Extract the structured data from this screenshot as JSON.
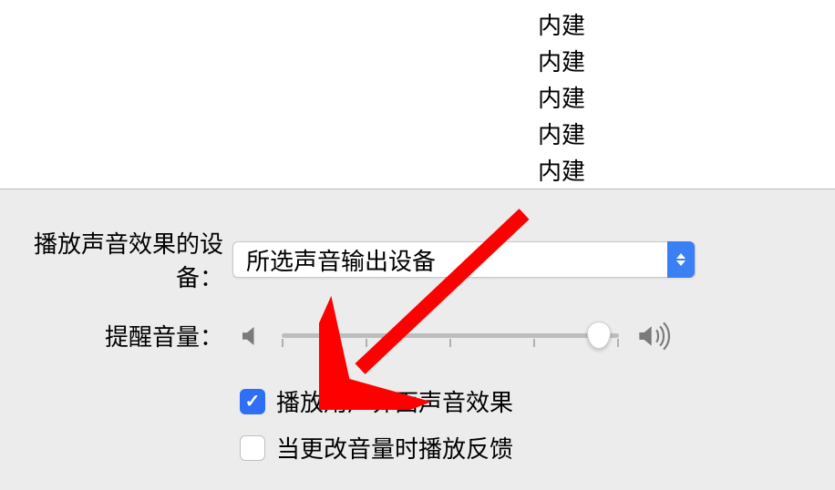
{
  "list": {
    "items": [
      "内建",
      "内建",
      "内建",
      "内建",
      "内建"
    ]
  },
  "device_row": {
    "label": "播放声音效果的设备：",
    "selected": "所选声音输出设备"
  },
  "volume_row": {
    "label": "提醒音量："
  },
  "checkboxes": {
    "play_ui_sounds": {
      "label": "播放用户界面声音效果",
      "checked": true
    },
    "feedback_on_change": {
      "label": "当更改音量时播放反馈",
      "checked": false
    }
  }
}
